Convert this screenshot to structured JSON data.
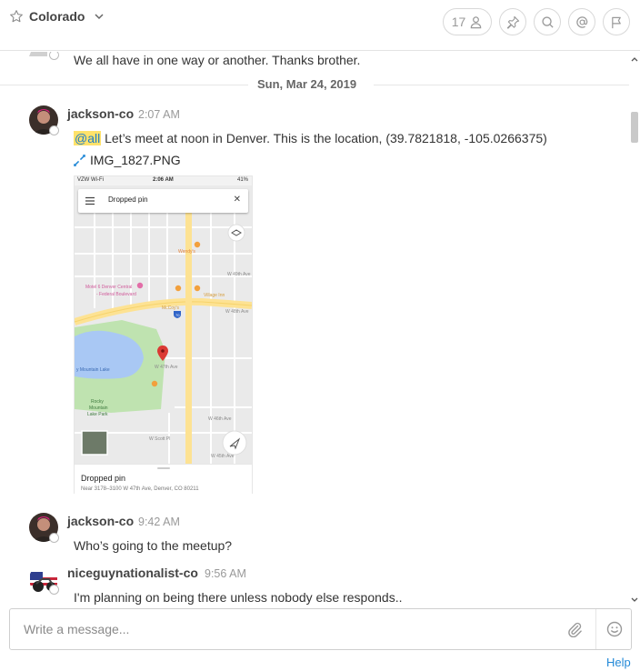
{
  "channel": {
    "name": "Colorado"
  },
  "header": {
    "member_count": "17"
  },
  "messages": {
    "previous_text": "We all have in one way or another. Thanks brother.",
    "date_separator": "Sun, Mar 24, 2019",
    "posts": [
      {
        "author": "jackson-co",
        "time": "2:07 AM",
        "mention": "@all",
        "text": " Let’s meet at noon in Denver. This is the location, (39.7821818, -105.0266375)",
        "file_name": "IMG_1827.PNG"
      },
      {
        "author": "jackson-co",
        "time": "9:42 AM",
        "text": "Who’s going to the meetup?"
      },
      {
        "author": "niceguynationalist-co",
        "time": "9:56 AM",
        "text": "I'm planning on being there unless nobody else responds.."
      }
    ]
  },
  "attachment_preview": {
    "status_carrier": "VZW Wi-Fi",
    "status_time": "2:06 AM",
    "status_battery": "41%",
    "search_title": "Dropped pin",
    "map_labels": {
      "mcdonalds": "McDonald's",
      "wendys": "Wendy's",
      "motel6_line1": "Motel 6 Denver Central",
      "motel6_line2": "- Federal Boulevard",
      "mccoys": "McCoy's",
      "village_inn": "Village Inn",
      "lake": "y Mountain Lake",
      "park_line1": "Rocky",
      "park_line2": "Mountain",
      "park_line3": "Lake Park",
      "w48th": "W 48th Ave",
      "w49th": "W 49th Ave",
      "w47th": "W 47th Ave",
      "w46th": "W 46th Ave",
      "w45th": "W 45th Ave",
      "w_scott": "W Scott Pl",
      "interstate": "70"
    },
    "pin_title": "Dropped pin",
    "pin_address": "Near 3178–3100 W 47th Ave, Denver, CO 80211"
  },
  "composer": {
    "placeholder": "Write a message..."
  },
  "footer": {
    "help": "Help"
  },
  "colors": {
    "accent": "#2389d7",
    "mention_bg": "#ffe26b",
    "mention_text": "#1f7dc7"
  }
}
